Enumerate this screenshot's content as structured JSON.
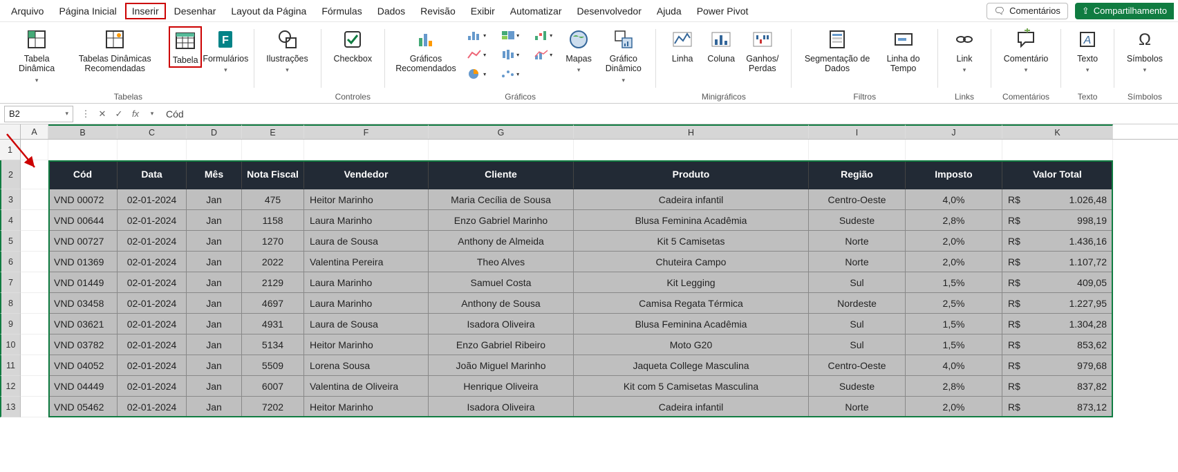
{
  "menu": {
    "tabs": [
      "Arquivo",
      "Página Inicial",
      "Inserir",
      "Desenhar",
      "Layout da Página",
      "Fórmulas",
      "Dados",
      "Revisão",
      "Exibir",
      "Automatizar",
      "Desenvolvedor",
      "Ajuda",
      "Power Pivot"
    ],
    "active_index": 2,
    "comments": "Comentários",
    "share": "Compartilhamento"
  },
  "ribbon": {
    "groups": {
      "tabelas": {
        "label": "Tabelas",
        "pivot": "Tabela\nDinâmica",
        "pivot_rec": "Tabelas Dinâmicas\nRecomendadas",
        "table": "Tabela",
        "forms": "Formulários"
      },
      "ilustracoes": "Ilustrações",
      "controles": {
        "label": "Controles",
        "checkbox": "Checkbox"
      },
      "graficos": {
        "label": "Gráficos",
        "rec": "Gráficos\nRecomendados",
        "mapas": "Mapas",
        "pivotchart": "Gráfico\nDinâmico"
      },
      "minigraficos": {
        "label": "Minigráficos",
        "line": "Linha",
        "col": "Coluna",
        "winloss": "Ganhos/\nPerdas"
      },
      "filtros": {
        "label": "Filtros",
        "slicer": "Segmentação\nde Dados",
        "timeline": "Linha do\nTempo"
      },
      "links": {
        "label": "Links",
        "link": "Link"
      },
      "comentarios": {
        "label": "Comentários",
        "comment": "Comentário"
      },
      "texto": {
        "label": "Texto",
        "text": "Texto"
      },
      "simbolos": {
        "label": "Símbolos",
        "sym": "Símbolos"
      }
    }
  },
  "formula_bar": {
    "cell_ref": "B2",
    "formula": "Cód"
  },
  "columns": [
    "A",
    "B",
    "C",
    "D",
    "E",
    "F",
    "G",
    "H",
    "I",
    "J",
    "K"
  ],
  "selected_cols": [
    "B",
    "C",
    "D",
    "E",
    "F",
    "G",
    "H",
    "I",
    "J",
    "K"
  ],
  "row_numbers": [
    1,
    2,
    3,
    4,
    5,
    6,
    7,
    8,
    9,
    10,
    11,
    12,
    13
  ],
  "selected_rows": [
    2,
    3,
    4,
    5,
    6,
    7,
    8,
    9,
    10,
    11,
    12,
    13
  ],
  "table": {
    "headers": [
      "Cód",
      "Data",
      "Mês",
      "Nota Fiscal",
      "Vendedor",
      "Cliente",
      "Produto",
      "Região",
      "Imposto",
      "Valor Total"
    ],
    "currency": "R$",
    "rows": [
      {
        "cod": "VND 00072",
        "data": "02-01-2024",
        "mes": "Jan",
        "nf": "475",
        "vendedor": "Heitor Marinho",
        "cliente": "Maria Cecília de Sousa",
        "produto": "Cadeira infantil",
        "regiao": "Centro-Oeste",
        "imposto": "4,0%",
        "valor": "1.026,48"
      },
      {
        "cod": "VND 00644",
        "data": "02-01-2024",
        "mes": "Jan",
        "nf": "1158",
        "vendedor": "Laura Marinho",
        "cliente": "Enzo Gabriel Marinho",
        "produto": "Blusa Feminina Acadêmia",
        "regiao": "Sudeste",
        "imposto": "2,8%",
        "valor": "998,19"
      },
      {
        "cod": "VND 00727",
        "data": "02-01-2024",
        "mes": "Jan",
        "nf": "1270",
        "vendedor": "Laura de Sousa",
        "cliente": "Anthony de Almeida",
        "produto": "Kit 5 Camisetas",
        "regiao": "Norte",
        "imposto": "2,0%",
        "valor": "1.436,16"
      },
      {
        "cod": "VND 01369",
        "data": "02-01-2024",
        "mes": "Jan",
        "nf": "2022",
        "vendedor": "Valentina Pereira",
        "cliente": "Theo Alves",
        "produto": "Chuteira Campo",
        "regiao": "Norte",
        "imposto": "2,0%",
        "valor": "1.107,72"
      },
      {
        "cod": "VND 01449",
        "data": "02-01-2024",
        "mes": "Jan",
        "nf": "2129",
        "vendedor": "Laura Marinho",
        "cliente": "Samuel Costa",
        "produto": "Kit Legging",
        "regiao": "Sul",
        "imposto": "1,5%",
        "valor": "409,05"
      },
      {
        "cod": "VND 03458",
        "data": "02-01-2024",
        "mes": "Jan",
        "nf": "4697",
        "vendedor": "Laura Marinho",
        "cliente": "Anthony de Sousa",
        "produto": "Camisa Regata Térmica",
        "regiao": "Nordeste",
        "imposto": "2,5%",
        "valor": "1.227,95"
      },
      {
        "cod": "VND 03621",
        "data": "02-01-2024",
        "mes": "Jan",
        "nf": "4931",
        "vendedor": "Laura de Sousa",
        "cliente": "Isadora Oliveira",
        "produto": "Blusa Feminina Acadêmia",
        "regiao": "Sul",
        "imposto": "1,5%",
        "valor": "1.304,28"
      },
      {
        "cod": "VND 03782",
        "data": "02-01-2024",
        "mes": "Jan",
        "nf": "5134",
        "vendedor": "Heitor Marinho",
        "cliente": "Enzo Gabriel Ribeiro",
        "produto": "Moto G20",
        "regiao": "Sul",
        "imposto": "1,5%",
        "valor": "853,62"
      },
      {
        "cod": "VND 04052",
        "data": "02-01-2024",
        "mes": "Jan",
        "nf": "5509",
        "vendedor": "Lorena Sousa",
        "cliente": "João Miguel Marinho",
        "produto": "Jaqueta College Masculina",
        "regiao": "Centro-Oeste",
        "imposto": "4,0%",
        "valor": "979,68"
      },
      {
        "cod": "VND 04449",
        "data": "02-01-2024",
        "mes": "Jan",
        "nf": "6007",
        "vendedor": "Valentina de Oliveira",
        "cliente": "Henrique Oliveira",
        "produto": "Kit com 5 Camisetas Masculina",
        "regiao": "Sudeste",
        "imposto": "2,8%",
        "valor": "837,82"
      },
      {
        "cod": "VND 05462",
        "data": "02-01-2024",
        "mes": "Jan",
        "nf": "7202",
        "vendedor": "Heitor Marinho",
        "cliente": "Isadora Oliveira",
        "produto": "Cadeira infantil",
        "regiao": "Norte",
        "imposto": "2,0%",
        "valor": "873,12"
      }
    ]
  }
}
